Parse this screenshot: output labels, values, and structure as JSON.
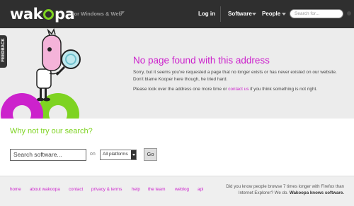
{
  "header": {
    "logo": "wakoopa",
    "tagline": "for Windows & Web",
    "nav": {
      "login": "Log in",
      "software": "Software",
      "people": "People"
    },
    "search_placeholder": "Search for..."
  },
  "feedback": {
    "label": "FEEDBACK"
  },
  "error": {
    "title": "No page found with this address",
    "body1": "Sorry, but it seems you've requested a page that no longer exists or has never existed on our website. Don't blame Kooper here though, he tried hard.",
    "body2_prefix": "Please look over the address one more time or",
    "contact_link": "contact us",
    "body2_suffix": "if you think something is not right."
  },
  "search": {
    "title": "Why not try our search?",
    "input_value": "Search software...",
    "on_label": "on",
    "platform_value": "All platforms",
    "go_label": "Go"
  },
  "footer": {
    "links": [
      "home",
      "about wakoopa",
      "contact",
      "privacy & terms",
      "help",
      "the team",
      "weblog",
      "api"
    ],
    "promo_line1": "Did you know people browse 7 times longer with Firefox than",
    "promo_line2_prefix": "Internet Explorer? We do.",
    "promo_bold": "Wakoopa knows software."
  },
  "colors": {
    "accent_magenta": "#cc22cc",
    "accent_green": "#7ed321",
    "header_bg": "#2f2f2f"
  },
  "icons": {
    "mascot": "kooper-magnifying-glass-mascot"
  }
}
